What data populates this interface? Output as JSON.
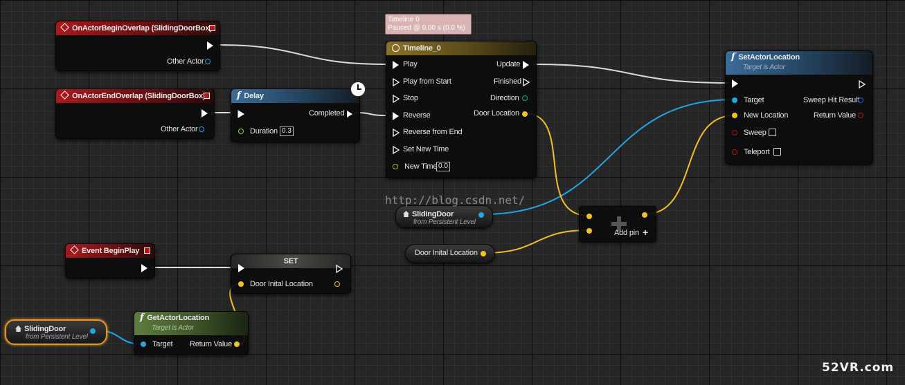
{
  "colors": {
    "exec": "#ffffff",
    "object_pin": "#1fa7e6",
    "vector_pin": "#f5c026",
    "bool_pin": "#8d0f12",
    "float_pin": "#8fd42a",
    "event_header": "#a8191d",
    "function_header": "#3b6c98",
    "timeline_header": "#8a7128",
    "pure_header": "#5e7d3e"
  },
  "nodes": {
    "begin_overlap": {
      "title": "OnActorBeginOverlap (SlidingDoorBox)",
      "pin_other": "Other Actor"
    },
    "end_overlap": {
      "title": "OnActorEndOverlap (SlidingDoorBox)",
      "pin_other": "Other Actor"
    },
    "delay": {
      "title": "Delay",
      "pin_completed": "Completed",
      "pin_duration": "Duration",
      "duration_value": "0.3"
    },
    "timeline": {
      "tooltip_line1": "Timeline 0",
      "tooltip_line2": "Paused @ 0.00 s (0.0 %)",
      "title": "Timeline_0",
      "inputs": [
        "Play",
        "Play from Start",
        "Stop",
        "Reverse",
        "Reverse from End",
        "Set New Time"
      ],
      "new_time_label": "New Time",
      "new_time_value": "0.0",
      "outputs": [
        "Update",
        "Finished",
        "Direction",
        "Door Location"
      ]
    },
    "set_actor_location": {
      "title": "SetActorLocation",
      "subtitle": "Target is Actor",
      "pin_target": "Target",
      "pin_new_location": "New Location",
      "pin_sweep": "Sweep",
      "pin_teleport": "Teleport",
      "pin_sweep_hit": "Sweep Hit Result",
      "pin_return": "Return Value"
    },
    "sliding_door_1": {
      "title": "SlidingDoor",
      "subtitle": "from Persistent Level"
    },
    "door_initial_get": {
      "title": "Door Inital Location"
    },
    "add_node": {
      "add_pin": "Add pin"
    },
    "begin_play": {
      "title": "Event BeginPlay"
    },
    "set_node": {
      "title": "SET",
      "pin_var": "Door Inital Location"
    },
    "sliding_door_2": {
      "title": "SlidingDoor",
      "subtitle": "from Persistent Level"
    },
    "get_actor_location": {
      "title": "GetActorLocation",
      "subtitle": "Target is Actor",
      "pin_target": "Target",
      "pin_return": "Return Value"
    }
  },
  "watermark": "http://blog.csdn.net/",
  "logo": "52VR.com"
}
